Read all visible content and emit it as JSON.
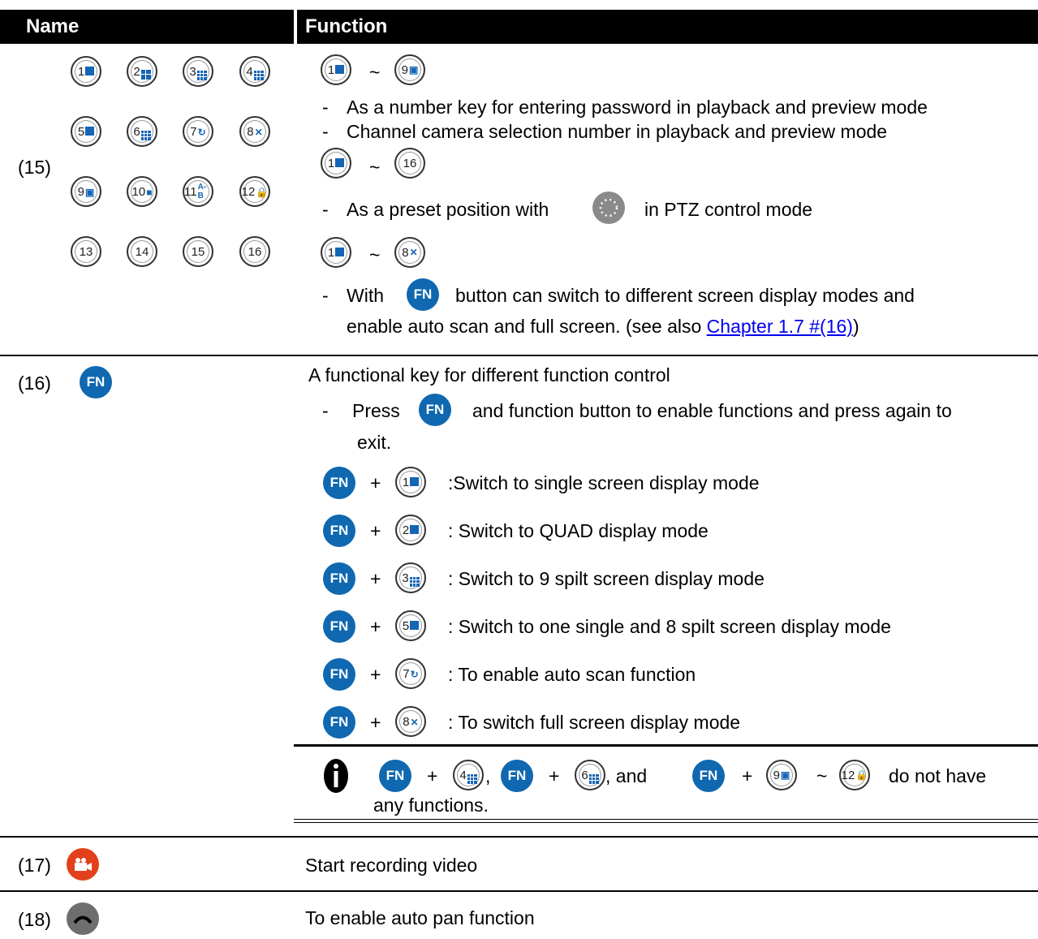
{
  "header": {
    "name": "Name",
    "function": "Function"
  },
  "row15": {
    "label": "(15)",
    "keys": [
      "1",
      "2",
      "3",
      "4",
      "5",
      "6",
      "7",
      "8",
      "9",
      "10",
      "11",
      "12",
      "13",
      "14",
      "15",
      "16"
    ],
    "key11_glyph": "A-B",
    "tilde": "~",
    "bullet1": "As a number key for entering password in playback and preview mode",
    "bullet2": "Channel camera selection number in playback and preview mode",
    "bullet3_pre": "As a preset position with",
    "bullet3_post": "in PTZ control mode",
    "bullet4_pre": "With",
    "bullet4_post": "button can switch to different screen display modes and",
    "bullet4_line2": "enable auto scan and full screen. (see also",
    "bullet4_link": "Chapter 1.7 #(16)",
    "bullet4_close": ")",
    "dash": "-"
  },
  "row16": {
    "label": "(16)",
    "fn": "FN",
    "intro": "A functional key for different function control",
    "press_pre": "Press",
    "press_post": "and function button to enable functions and press again to",
    "press_line2": "exit.",
    "plus": "+",
    "combos": [
      {
        "key": "1",
        "text": ":Switch to single screen display mode"
      },
      {
        "key": "2",
        "text": ": Switch to QUAD display mode"
      },
      {
        "key": "3",
        "text": ": Switch to 9 spilt screen display mode"
      },
      {
        "key": "5",
        "text": ": Switch to one single and 8 spilt screen display mode"
      },
      {
        "key": "7",
        "text": ": To enable auto scan function"
      },
      {
        "key": "8",
        "text": ": To switch full screen display mode"
      }
    ],
    "note_comma": ",",
    "note_and": ", and",
    "note_end": "do not have",
    "note_line2": "any functions.",
    "note_icon": "i"
  },
  "row17": {
    "label": "(17)",
    "text": "Start recording video"
  },
  "row18": {
    "label": "(18)",
    "text": "To enable auto pan function"
  },
  "colors": {
    "fn_blue": "#0f68b0",
    "key_blue": "#1565b6",
    "record_red": "#e2401c",
    "pan_gray": "#6e6e6e"
  }
}
